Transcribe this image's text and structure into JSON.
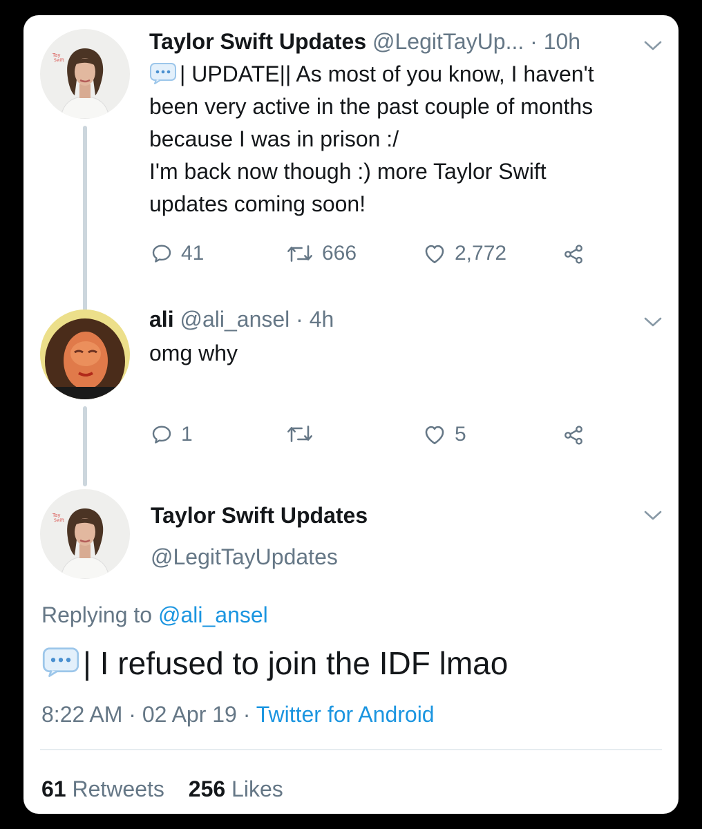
{
  "tweet1": {
    "display_name": "Taylor Swift Updates",
    "handle": "@LegitTayUp...",
    "time": "· 10h",
    "lines": [
      "| UPDATE|| As most of you know, I haven't",
      "been very active in the past couple of months",
      "because I was in prison :/",
      "I'm back now though :) more Taylor Swift",
      "updates coming soon!"
    ],
    "replies": "41",
    "retweets": "666",
    "likes": "2,772"
  },
  "reply": {
    "display_name": "ali",
    "handle": "@ali_ansel",
    "time": "· 4h",
    "text": "omg why",
    "replies": "1",
    "retweets": "",
    "likes": "5"
  },
  "focused": {
    "display_name": "Taylor Swift Updates",
    "handle": "@LegitTayUpdates",
    "replying_label": "Replying to",
    "replying_handle": "@ali_ansel",
    "text": "| I refused to join the IDF lmao",
    "timestamp": "8:22 AM · 02 Apr 19 ·",
    "source": "Twitter for Android",
    "retweet_count": "61",
    "retweet_label": "Retweets",
    "like_count": "256",
    "like_label": "Likes"
  },
  "colors": {
    "link": "#1b95e0",
    "muted": "#657786",
    "thread_line": "#ccd6dd"
  },
  "icons": [
    "speech-bubble-icon",
    "reply-icon",
    "retweet-icon",
    "like-icon",
    "share-icon",
    "chevron-down-icon"
  ]
}
